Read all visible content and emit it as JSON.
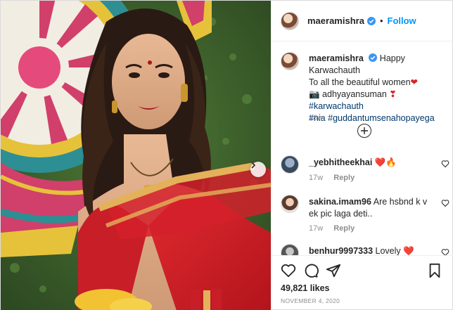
{
  "post": {
    "username": "maeramishra",
    "follow_label": "Follow",
    "caption": {
      "username": "maeramishra",
      "line1": "Happy Karwachauth",
      "line2": "To all the beautiful women",
      "line3_prefix": "📷 adhyayansuman ",
      "hashtag_1": "#karwachauth",
      "hashtag_2": "#nia",
      "hashtag_3": "#guddantumsenahopayega",
      "time": "18w"
    },
    "comments": [
      {
        "username": "_yebhitheekhai",
        "text": "❤️🔥",
        "time": "17w",
        "reply_label": "Reply"
      },
      {
        "username": "sakina.imam96",
        "text": "Are hsbnd k v ek pic laga deti..",
        "time": "17w",
        "reply_label": "Reply"
      },
      {
        "username": "benhur9997333",
        "text": "Lovely ❤️",
        "time": "",
        "reply_label": ""
      }
    ],
    "likes": "49,821 likes",
    "date": "NOVEMBER 4, 2020"
  },
  "colors": {
    "accent": "#0095f6",
    "heart": "#d8232a",
    "saree_red": "#d4202a"
  },
  "icons": [
    "verified-badge-icon",
    "add-circle-icon",
    "heart-icon",
    "comment-icon",
    "share-icon",
    "bookmark-icon",
    "chevron-right-icon"
  ]
}
